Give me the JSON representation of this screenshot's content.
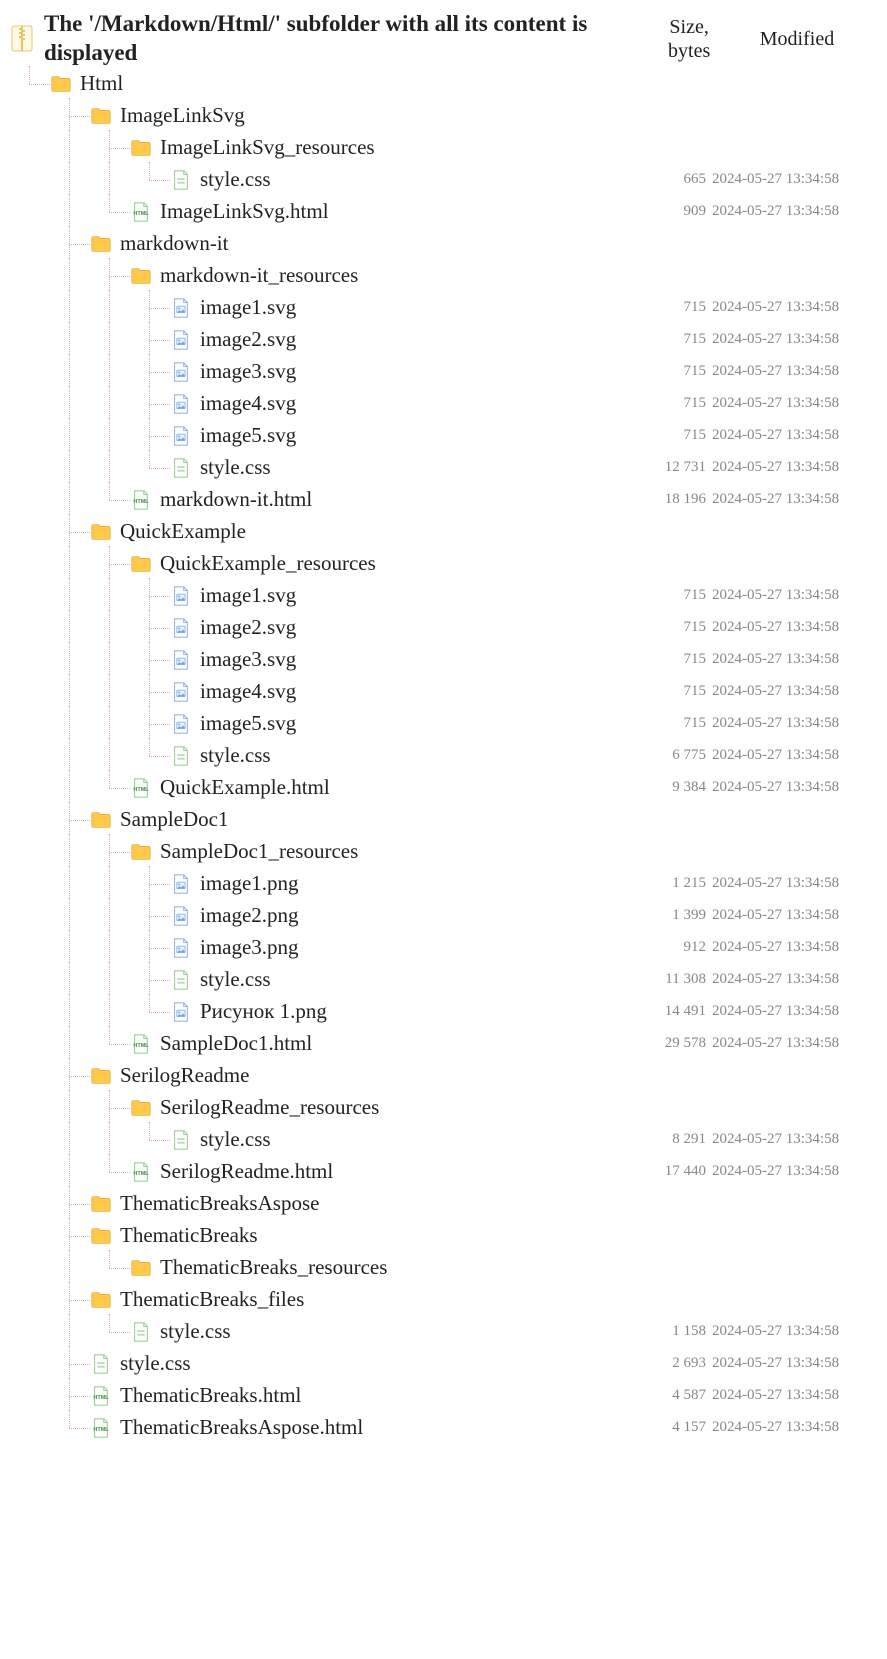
{
  "header": {
    "title": "The '/Markdown/Html/' subfolder with all its content is displayed",
    "size_label": "Size, bytes",
    "modified_label": "Modified"
  },
  "icons": {
    "root": "zip-icon",
    "folder": "folder-icon",
    "html": "html-icon",
    "css": "css-icon",
    "image": "image-icon"
  },
  "tree": {
    "name": "root",
    "icon": "root",
    "children": [
      {
        "name": "Html",
        "icon": "folder",
        "children": [
          {
            "name": "ImageLinkSvg",
            "icon": "folder",
            "children": [
              {
                "name": "ImageLinkSvg_resources",
                "icon": "folder",
                "children": [
                  {
                    "name": "style.css",
                    "icon": "css",
                    "size": "665",
                    "modified": "2024-05-27 13:34:58"
                  }
                ]
              },
              {
                "name": "ImageLinkSvg.html",
                "icon": "html",
                "size": "909",
                "modified": "2024-05-27 13:34:58"
              }
            ]
          },
          {
            "name": "markdown-it",
            "icon": "folder",
            "children": [
              {
                "name": "markdown-it_resources",
                "icon": "folder",
                "children": [
                  {
                    "name": "image1.svg",
                    "icon": "image",
                    "size": "715",
                    "modified": "2024-05-27 13:34:58"
                  },
                  {
                    "name": "image2.svg",
                    "icon": "image",
                    "size": "715",
                    "modified": "2024-05-27 13:34:58"
                  },
                  {
                    "name": "image3.svg",
                    "icon": "image",
                    "size": "715",
                    "modified": "2024-05-27 13:34:58"
                  },
                  {
                    "name": "image4.svg",
                    "icon": "image",
                    "size": "715",
                    "modified": "2024-05-27 13:34:58"
                  },
                  {
                    "name": "image5.svg",
                    "icon": "image",
                    "size": "715",
                    "modified": "2024-05-27 13:34:58"
                  },
                  {
                    "name": "style.css",
                    "icon": "css",
                    "size": "12 731",
                    "modified": "2024-05-27 13:34:58"
                  }
                ]
              },
              {
                "name": "markdown-it.html",
                "icon": "html",
                "size": "18 196",
                "modified": "2024-05-27 13:34:58"
              }
            ]
          },
          {
            "name": "QuickExample",
            "icon": "folder",
            "children": [
              {
                "name": "QuickExample_resources",
                "icon": "folder",
                "children": [
                  {
                    "name": "image1.svg",
                    "icon": "image",
                    "size": "715",
                    "modified": "2024-05-27 13:34:58"
                  },
                  {
                    "name": "image2.svg",
                    "icon": "image",
                    "size": "715",
                    "modified": "2024-05-27 13:34:58"
                  },
                  {
                    "name": "image3.svg",
                    "icon": "image",
                    "size": "715",
                    "modified": "2024-05-27 13:34:58"
                  },
                  {
                    "name": "image4.svg",
                    "icon": "image",
                    "size": "715",
                    "modified": "2024-05-27 13:34:58"
                  },
                  {
                    "name": "image5.svg",
                    "icon": "image",
                    "size": "715",
                    "modified": "2024-05-27 13:34:58"
                  },
                  {
                    "name": "style.css",
                    "icon": "css",
                    "size": "6 775",
                    "modified": "2024-05-27 13:34:58"
                  }
                ]
              },
              {
                "name": "QuickExample.html",
                "icon": "html",
                "size": "9 384",
                "modified": "2024-05-27 13:34:58"
              }
            ]
          },
          {
            "name": "SampleDoc1",
            "icon": "folder",
            "children": [
              {
                "name": "SampleDoc1_resources",
                "icon": "folder",
                "children": [
                  {
                    "name": "image1.png",
                    "icon": "image",
                    "size": "1 215",
                    "modified": "2024-05-27 13:34:58"
                  },
                  {
                    "name": "image2.png",
                    "icon": "image",
                    "size": "1 399",
                    "modified": "2024-05-27 13:34:58"
                  },
                  {
                    "name": "image3.png",
                    "icon": "image",
                    "size": "912",
                    "modified": "2024-05-27 13:34:58"
                  },
                  {
                    "name": "style.css",
                    "icon": "css",
                    "size": "11 308",
                    "modified": "2024-05-27 13:34:58"
                  },
                  {
                    "name": "Рисунок 1.png",
                    "icon": "image",
                    "size": "14 491",
                    "modified": "2024-05-27 13:34:58"
                  }
                ]
              },
              {
                "name": "SampleDoc1.html",
                "icon": "html",
                "size": "29 578",
                "modified": "2024-05-27 13:34:58"
              }
            ]
          },
          {
            "name": "SerilogReadme",
            "icon": "folder",
            "children": [
              {
                "name": "SerilogReadme_resources",
                "icon": "folder",
                "children": [
                  {
                    "name": "style.css",
                    "icon": "css",
                    "size": "8 291",
                    "modified": "2024-05-27 13:34:58"
                  }
                ]
              },
              {
                "name": "SerilogReadme.html",
                "icon": "html",
                "size": "17 440",
                "modified": "2024-05-27 13:34:58"
              }
            ]
          },
          {
            "name": "ThematicBreaksAspose",
            "icon": "folder",
            "children": []
          },
          {
            "name": "ThematicBreaks",
            "icon": "folder",
            "children": [
              {
                "name": "ThematicBreaks_resources",
                "icon": "folder",
                "children": []
              }
            ]
          },
          {
            "name": "ThematicBreaks_files",
            "icon": "folder",
            "children": [
              {
                "name": "style.css",
                "icon": "css",
                "size": "1 158",
                "modified": "2024-05-27 13:34:58"
              }
            ]
          },
          {
            "name": "style.css",
            "icon": "css",
            "size": "2 693",
            "modified": "2024-05-27 13:34:58"
          },
          {
            "name": "ThematicBreaks.html",
            "icon": "html",
            "size": "4 587",
            "modified": "2024-05-27 13:34:58"
          },
          {
            "name": "ThematicBreaksAspose.html",
            "icon": "html",
            "size": "4 157",
            "modified": "2024-05-27 13:34:58"
          }
        ]
      }
    ]
  }
}
